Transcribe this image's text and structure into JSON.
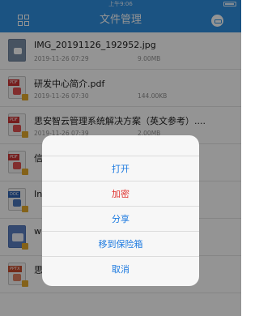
{
  "status_bar": {
    "carrier": "",
    "time": "上午9:06"
  },
  "nav": {
    "title": "文件管理",
    "left_icon": "grid-icon",
    "right_icon": "lock-box-icon"
  },
  "files": [
    {
      "name": "IMG_20191126_192952.jpg",
      "date": "2019-11-26 07:29",
      "size": "9.00MB",
      "icon": "image"
    },
    {
      "name": "研发中心简介.pdf",
      "date": "2019-11-26 07:30",
      "size": "144.00KB",
      "icon": "pdf"
    },
    {
      "name": "思安智云管理系统解决方案（英文参考）....",
      "date": "2019-11-26 07:39",
      "size": "2.00MB",
      "icon": "pdf"
    },
    {
      "name": "信",
      "date": "",
      "size": "",
      "icon": "pdf"
    },
    {
      "name": "In                                                   doc",
      "date": "",
      "size": "",
      "icon": "doc"
    },
    {
      "name": "w",
      "date": "",
      "size": "",
      "icon": "word"
    },
    {
      "name": "思",
      "date": "",
      "size": "",
      "icon": "ppt"
    }
  ],
  "action_sheet": {
    "items": [
      {
        "label": "打开",
        "style": "default"
      },
      {
        "label": "加密",
        "style": "danger"
      },
      {
        "label": "分享",
        "style": "default"
      },
      {
        "label": "移到保险箱",
        "style": "default"
      },
      {
        "label": "取消",
        "style": "default"
      }
    ]
  },
  "colors": {
    "navbar": "#2f8fe0",
    "action": "#1e7be0",
    "danger": "#e0322e"
  }
}
